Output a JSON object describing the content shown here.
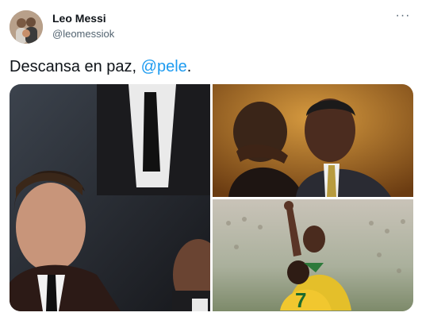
{
  "author": {
    "display_name": "Leo Messi",
    "handle": "@leomessiok",
    "avatar_icon": "avatar-photo"
  },
  "more_icon": "more-options-icon",
  "tweet": {
    "text_prefix": "Descansa en paz, ",
    "mention": "@pele",
    "text_suffix": "."
  },
  "colors": {
    "link": "#1d9bf0",
    "secondary_text": "#536471",
    "primary_text": "#0f1419"
  },
  "media": {
    "photos": [
      {
        "alt": "photo-1"
      },
      {
        "alt": "photo-2"
      },
      {
        "alt": "photo-3"
      }
    ]
  }
}
